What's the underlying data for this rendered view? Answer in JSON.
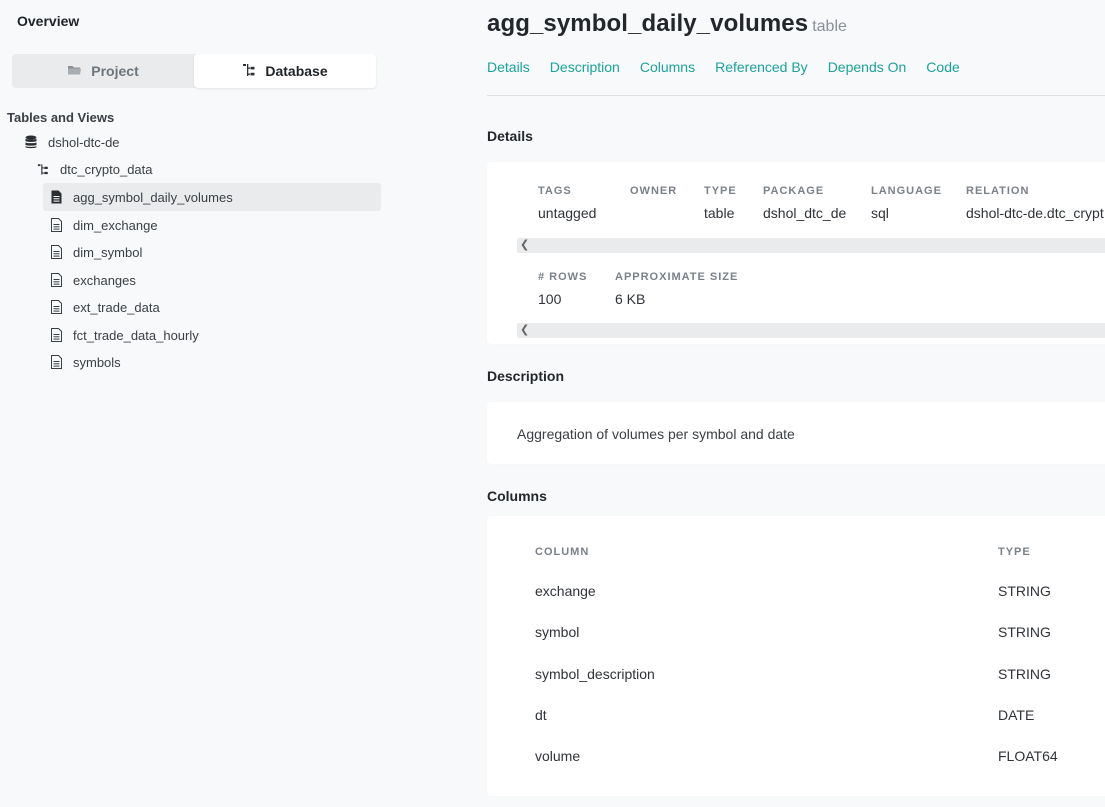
{
  "sidebar": {
    "overview_label": "Overview",
    "switcher": {
      "project_label": "Project",
      "database_label": "Database"
    },
    "tables_heading": "Tables and Views",
    "database_name": "dshol-dtc-de",
    "schema_name": "dtc_crypto_data",
    "tables": [
      "agg_symbol_daily_volumes",
      "dim_exchange",
      "dim_symbol",
      "exchanges",
      "ext_trade_data",
      "fct_trade_data_hourly",
      "symbols"
    ]
  },
  "main": {
    "title": "agg_symbol_daily_volumes",
    "kind": "table",
    "tabs": [
      "Details",
      "Description",
      "Columns",
      "Referenced By",
      "Depends On",
      "Code"
    ],
    "details": {
      "heading": "Details",
      "row1": [
        {
          "label": "TAGS",
          "value": "untagged"
        },
        {
          "label": "OWNER",
          "value": ""
        },
        {
          "label": "TYPE",
          "value": "table"
        },
        {
          "label": "PACKAGE",
          "value": "dshol_dtc_de"
        },
        {
          "label": "LANGUAGE",
          "value": "sql"
        },
        {
          "label": "RELATION",
          "value": "dshol-dtc-de.dtc_crypt"
        }
      ],
      "row2": [
        {
          "label": "# ROWS",
          "value": "100"
        },
        {
          "label": "APPROXIMATE SIZE",
          "value": "6 KB"
        }
      ]
    },
    "description": {
      "heading": "Description",
      "text": "Aggregation of volumes per symbol and date"
    },
    "columns": {
      "heading": "Columns",
      "header_column": "COLUMN",
      "header_type": "TYPE",
      "rows": [
        {
          "name": "exchange",
          "type": "STRING"
        },
        {
          "name": "symbol",
          "type": "STRING"
        },
        {
          "name": "symbol_description",
          "type": "STRING"
        },
        {
          "name": "dt",
          "type": "DATE"
        },
        {
          "name": "volume",
          "type": "FLOAT64"
        }
      ]
    }
  },
  "colors": {
    "accent": "#1aa39a",
    "selected_bg": "#e9ebed",
    "page_bg": "#f8f9fa"
  },
  "icons": {
    "project": "folder-icon",
    "database": "tree-icon",
    "db": "database-icon",
    "schema": "tree-icon",
    "table": "document-icon"
  }
}
